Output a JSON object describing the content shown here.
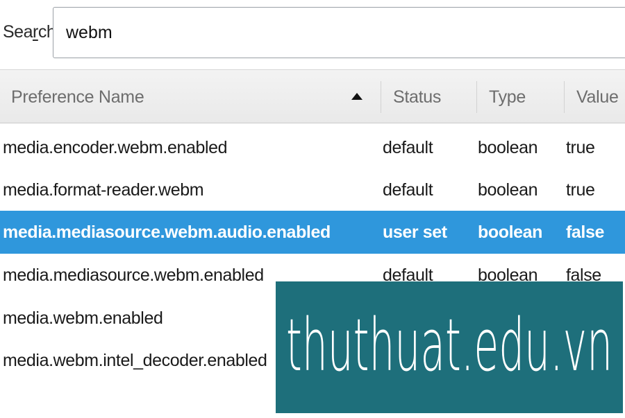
{
  "search": {
    "label": "Search:",
    "value": "webm"
  },
  "columns": {
    "name": "Preference Name",
    "status": "Status",
    "type": "Type",
    "value": "Value",
    "sort_icon": "sort-ascending-icon"
  },
  "rows": [
    {
      "name": "media.encoder.webm.enabled",
      "status": "default",
      "type": "boolean",
      "value": "true"
    },
    {
      "name": "media.format-reader.webm",
      "status": "default",
      "type": "boolean",
      "value": "true"
    },
    {
      "name": "media.mediasource.webm.audio.enabled",
      "status": "user set",
      "type": "boolean",
      "value": "false"
    },
    {
      "name": "media.mediasource.webm.enabled",
      "status": "default",
      "type": "boolean",
      "value": "false"
    },
    {
      "name": "media.webm.enabled",
      "status": "",
      "type": "",
      "value": ""
    },
    {
      "name": "media.webm.intel_decoder.enabled",
      "status": "",
      "type": "",
      "value": ""
    }
  ],
  "selected_row": 2,
  "watermark": {
    "text": "thuthuat.edu.vn"
  },
  "colors": {
    "selection": "#2f97dc",
    "watermark_bg": "#1e6f7b"
  }
}
